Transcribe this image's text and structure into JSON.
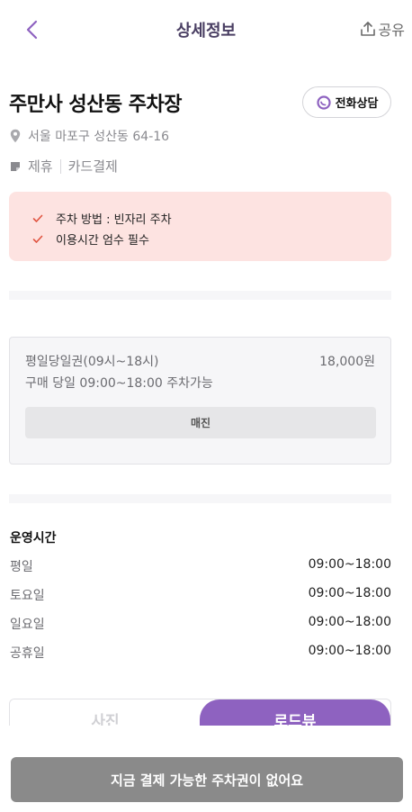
{
  "header": {
    "title": "상세정보",
    "share_label": "공유"
  },
  "lot": {
    "name": "주만사 성산동 주차장",
    "call_label": "전화상담",
    "address": "서울 마포구 성산동 64-16",
    "tags": [
      "제휴",
      "카드결제"
    ]
  },
  "notice": {
    "items": [
      "주차 방법 : 빈자리 주차",
      "이용시간 엄수 필수"
    ]
  },
  "ticket": {
    "name": "평일당일권(09시~18시)",
    "price": "18,000원",
    "description": "구매 당일 09:00~18:00 주차가능",
    "status_label": "매진"
  },
  "hours": {
    "title": "운영시간",
    "rows": [
      {
        "day": "평일",
        "time": "09:00~18:00"
      },
      {
        "day": "토요일",
        "time": "09:00~18:00"
      },
      {
        "day": "일요일",
        "time": "09:00~18:00"
      },
      {
        "day": "공휴일",
        "time": "09:00~18:00"
      }
    ]
  },
  "tabs": {
    "photo": "사진",
    "roadview": "로드뷰"
  },
  "footer": {
    "pay_label": "지금 결제 가능한 주차권이 없어요"
  },
  "colors": {
    "accent": "#8e62c0",
    "notice_bg": "#fde3e1",
    "check": "#e0533f",
    "disabled_button": "#8a8a8a"
  }
}
